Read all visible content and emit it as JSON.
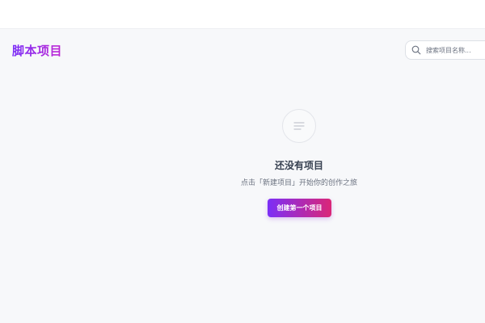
{
  "header": {
    "brand": "脚本项目"
  },
  "search": {
    "placeholder": "搜索项目名称...",
    "icon": "search-icon"
  },
  "empty_state": {
    "icon": "document-lines-icon",
    "title": "还没有项目",
    "description": "点击「新建项目」开始你的创作之旅",
    "button_label": "创建第一个项目"
  },
  "colors": {
    "accent_start": "#7b2ff7",
    "accent_end": "#db2777",
    "background": "#f7f8fa"
  }
}
